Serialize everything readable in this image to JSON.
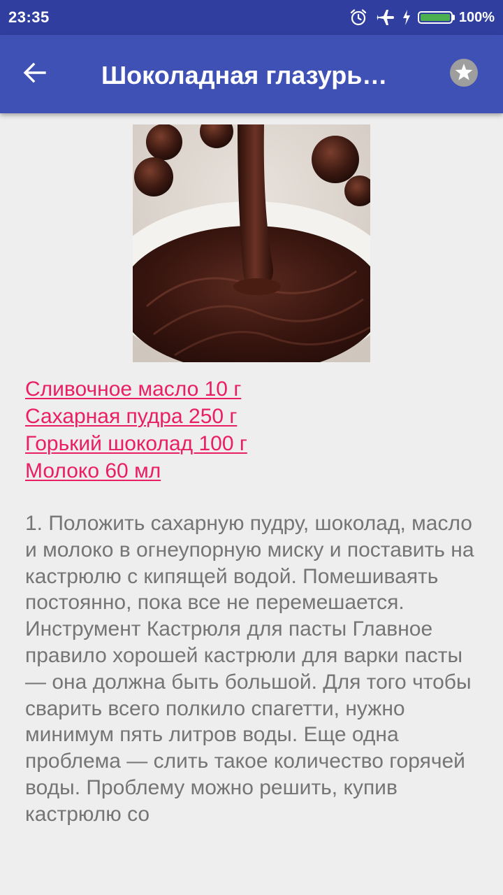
{
  "status_bar": {
    "time": "23:35",
    "battery_percent": "100%",
    "battery_level": 100,
    "battery_color": "#4caf50",
    "icons": [
      "alarm-clock-icon",
      "airplane-mode-icon",
      "charging-bolt-icon",
      "battery-icon"
    ]
  },
  "app_bar": {
    "title": "Шоколадная глазурь…",
    "back_icon": "arrow-back-icon",
    "favorite_icon": "star-icon",
    "background_color": "#3f51b5"
  },
  "recipe": {
    "image": "chocolate-glaze-photo",
    "ingredients": [
      "Сливочное масло 10 г",
      "Сахарная пудра 250 г",
      "Горький шоколад 100 г",
      "Молоко 60 мл"
    ],
    "ingredient_color": "#e91e63",
    "instructions": "1. Положить сахарную пудру, шоколад, масло и молоко в огнеупорную миску и поставить на кастрюлю с кипящей водой. Помешиваять постоянно, пока все не перемешается. Инструмент Кастрюля для пасты Главное правило хорошей кастрюли для варки пасты — она должна быть большой. Для того чтобы сварить всего полкило спагетти, нужно минимум пять литров воды. Еще одна проблема — слить такое количество горячей воды. Проблему можно решить, купив кастрюлю со"
  }
}
